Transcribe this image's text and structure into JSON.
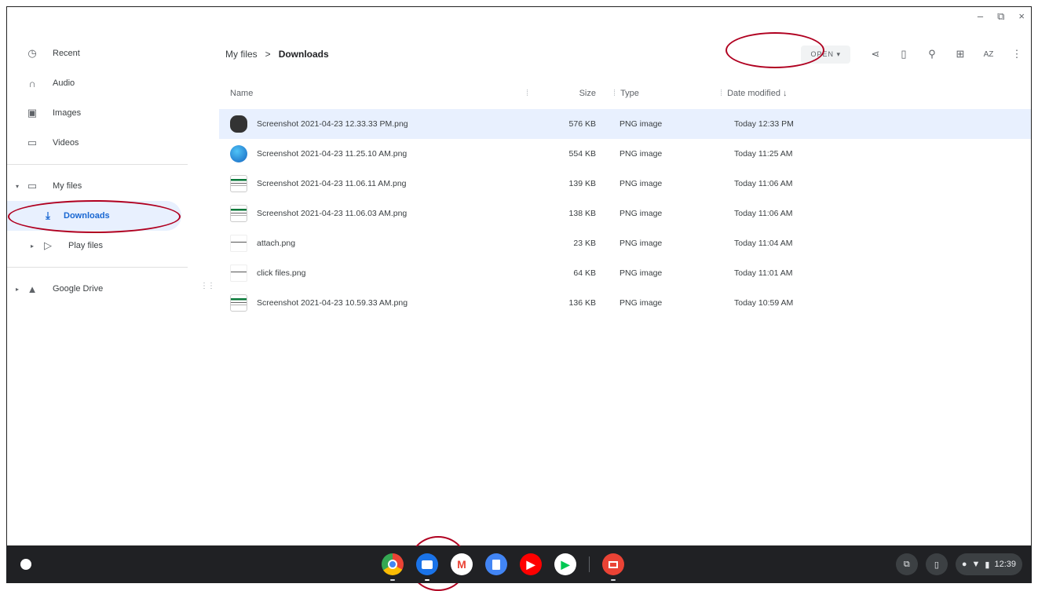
{
  "window": {
    "controls": [
      "–",
      "⧉",
      "×"
    ]
  },
  "sidebar": {
    "items": [
      {
        "label": "Recent",
        "icon": "clock-icon"
      },
      {
        "label": "Audio",
        "icon": "headphones-icon"
      },
      {
        "label": "Images",
        "icon": "image-icon"
      },
      {
        "label": "Videos",
        "icon": "video-icon"
      }
    ],
    "my_files": "My files",
    "downloads": "Downloads",
    "play_files": "Play files",
    "google_drive": "Google Drive"
  },
  "breadcrumb": {
    "root": "My files",
    "separator": ">",
    "current": "Downloads"
  },
  "toolbar": {
    "open_label": "OPEN ▾"
  },
  "table": {
    "headers": {
      "name": "Name",
      "size": "Size",
      "type": "Type",
      "date": "Date modified ↓"
    },
    "rows": [
      {
        "name": "Screenshot 2021-04-23 12.33.33 PM.png",
        "size": "576 KB",
        "type": "PNG image",
        "date": "Today 12:33 PM",
        "thumb": "camera"
      },
      {
        "name": "Screenshot 2021-04-23 11.25.10 AM.png",
        "size": "554 KB",
        "type": "PNG image",
        "date": "Today 11:25 AM",
        "thumb": "blue"
      },
      {
        "name": "Screenshot 2021-04-23 11.06.11 AM.png",
        "size": "139 KB",
        "type": "PNG image",
        "date": "Today 11:06 AM",
        "thumb": "doc"
      },
      {
        "name": "Screenshot 2021-04-23 11.06.03 AM.png",
        "size": "138 KB",
        "type": "PNG image",
        "date": "Today 11:06 AM",
        "thumb": "doc"
      },
      {
        "name": "attach.png",
        "size": "23 KB",
        "type": "PNG image",
        "date": "Today 11:04 AM",
        "thumb": "plain"
      },
      {
        "name": "click files.png",
        "size": "64 KB",
        "type": "PNG image",
        "date": "Today 11:01 AM",
        "thumb": "plain"
      },
      {
        "name": "Screenshot 2021-04-23 10.59.33 AM.png",
        "size": "136 KB",
        "type": "PNG image",
        "date": "Today 10:59 AM",
        "thumb": "doc"
      }
    ]
  },
  "shelf": {
    "apps": [
      "chrome-icon",
      "files-icon",
      "gmail-icon",
      "docs-icon",
      "youtube-icon",
      "play-store-icon",
      "slides-icon"
    ],
    "time": "12:39"
  }
}
